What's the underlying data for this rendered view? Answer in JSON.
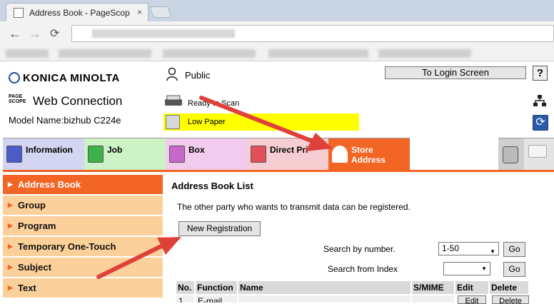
{
  "browser": {
    "tab_title": "Address Book - PageScop",
    "tab_close": "×",
    "back": "←",
    "forward": "→",
    "reload": "C"
  },
  "header": {
    "brand": "KONICA MINOLTA",
    "pagescope": "PAGE SCOPE",
    "product": "Web Connection",
    "model": "Model Name:bizhub C224e",
    "user": "Public",
    "login_button": "To Login Screen",
    "help_button": "?",
    "status": "Ready to Scan",
    "warning": "Low Paper",
    "network_icon": "network-icon",
    "refresh_glyph": "⟳"
  },
  "tabs": [
    {
      "label": "Information",
      "icon": "information-icon"
    },
    {
      "label": "Job",
      "icon": "job-icon"
    },
    {
      "label": "Box",
      "icon": "box-icon"
    },
    {
      "label": "Direct Pri",
      "icon": "direct-print-icon"
    },
    {
      "label_line1": "Store",
      "label_line2": "Address",
      "icon": "store-address-icon"
    },
    {
      "icon": "settings-icon"
    },
    {
      "icon": "monitor-icon"
    }
  ],
  "sidebar": {
    "items": [
      {
        "label": "Address Book",
        "active": true
      },
      {
        "label": "Group"
      },
      {
        "label": "Program"
      },
      {
        "label": "Temporary One-Touch"
      },
      {
        "label": "Subject"
      },
      {
        "label": "Text"
      }
    ]
  },
  "main": {
    "title": "Address Book List",
    "description": "The other party who wants to transmit data can be registered.",
    "new_registration": "New Registration",
    "search_number_label": "Search by number.",
    "search_number_value": "1-50",
    "search_index_label": "Search from Index",
    "search_index_value": "",
    "go": "Go",
    "table": {
      "headers": [
        "No.",
        "Function",
        "Name",
        "S/MIME",
        "Edit",
        "Delete"
      ],
      "row1": {
        "no": "1",
        "function": "E-mail",
        "name": "(redacted)",
        "edit": "Edit",
        "delete": "Delete"
      }
    }
  },
  "colors": {
    "accent": "#f36525",
    "sidebar_bg": "#fcd09a",
    "warning": "#ffff00",
    "arrow": "#e0403a"
  }
}
